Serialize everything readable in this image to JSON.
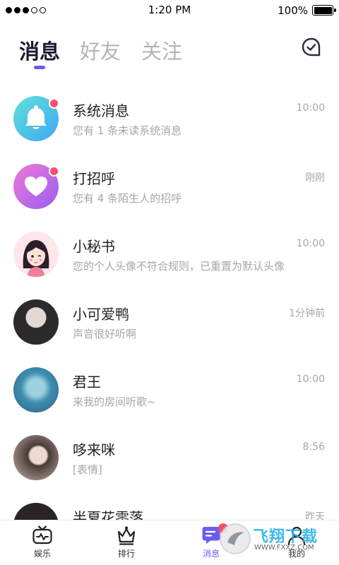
{
  "status_bar": {
    "time": "1:20 PM",
    "battery": "100%",
    "battery_level": 1.0
  },
  "tabs": [
    {
      "label": "消息",
      "active": true
    },
    {
      "label": "好友",
      "active": false
    },
    {
      "label": "关注",
      "active": false
    }
  ],
  "header": {
    "right_icon": "chat-bubble-check-icon"
  },
  "messages": [
    {
      "name": "系统消息",
      "time": "10:00",
      "preview": "您有 1 条未读系统消息",
      "avatar": "bell-icon",
      "unread": true
    },
    {
      "name": "打招呼",
      "time": "刚刚",
      "preview": "您有 4 条陌生人的招呼",
      "avatar": "heart-icon",
      "unread": true
    },
    {
      "name": "小秘书",
      "time": "10:00",
      "preview": "您的个人头像不符合规则，已重置为默认头像",
      "avatar": "cartoon-girl-avatar",
      "unread": false
    },
    {
      "name": "小可爱鸭",
      "time": "1分钟前",
      "preview": "声音很好听啊",
      "avatar": "user-photo",
      "unread": false
    },
    {
      "name": "君王",
      "time": "10:00",
      "preview": "来我的房间听歌~",
      "avatar": "user-photo",
      "unread": false
    },
    {
      "name": "哆来咪",
      "time": "8:56",
      "preview": "[表情]",
      "avatar": "user-photo",
      "unread": false
    },
    {
      "name": "半夏花零落",
      "time": "昨天",
      "preview": "",
      "avatar": "user-photo",
      "unread": false
    }
  ],
  "bottom_nav": [
    {
      "label": "娱乐",
      "icon": "tv-icon",
      "active": false
    },
    {
      "label": "排行",
      "icon": "crown-icon",
      "active": false
    },
    {
      "label": "消息",
      "icon": "message-icon",
      "active": true
    },
    {
      "label": "我的",
      "icon": "user-icon",
      "active": false
    }
  ],
  "watermark": {
    "title": "飞翔下载",
    "url": "WWW.FXXZ.COM"
  },
  "colors": {
    "accent": "#6a5cf0",
    "badge": "#f2506c",
    "muted": "#a5a5ad"
  }
}
